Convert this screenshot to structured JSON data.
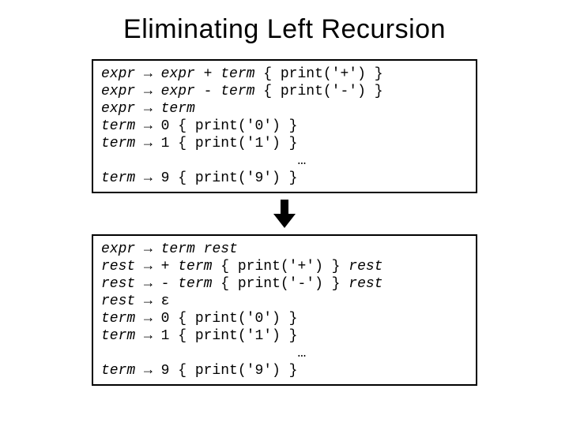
{
  "title": "Eliminating Left Recursion",
  "arrow": "→",
  "epsilon": "ε",
  "ellipsis": "…",
  "grammar1": {
    "lines": [
      {
        "lhs": "expr",
        "rhs_pre": "",
        "rhs_nt": "expr",
        "rhs_mid": " + ",
        "rhs_nt2": "term",
        "rhs_post": " { print('+') }"
      },
      {
        "lhs": "expr",
        "rhs_pre": "",
        "rhs_nt": "expr",
        "rhs_mid": " - ",
        "rhs_nt2": "term",
        "rhs_post": " { print('-') }"
      },
      {
        "lhs": "expr",
        "rhs_pre": "",
        "rhs_nt": "term",
        "rhs_mid": "",
        "rhs_nt2": "",
        "rhs_post": ""
      },
      {
        "lhs": "term",
        "rhs_pre": "0 { print('0') }",
        "rhs_nt": "",
        "rhs_mid": "",
        "rhs_nt2": "",
        "rhs_post": ""
      },
      {
        "lhs": "term",
        "rhs_pre": "1 { print('1') }",
        "rhs_nt": "",
        "rhs_mid": "",
        "rhs_nt2": "",
        "rhs_post": ""
      }
    ],
    "last": {
      "lhs": "term",
      "rhs_pre": "9 { print('9') }"
    }
  },
  "grammar2": {
    "lines": [
      {
        "lhs": "expr",
        "rhs_pre": "",
        "rhs_nt": "term",
        "rhs_mid": " ",
        "rhs_nt2": "rest",
        "rhs_post": ""
      },
      {
        "lhs": "rest",
        "rhs_pre": "+ ",
        "rhs_nt": "term",
        "rhs_mid": " { print('+') } ",
        "rhs_nt2": "rest",
        "rhs_post": ""
      },
      {
        "lhs": "rest",
        "rhs_pre": "- ",
        "rhs_nt": "term",
        "rhs_mid": " { print('-') } ",
        "rhs_nt2": "rest",
        "rhs_post": ""
      },
      {
        "lhs": "rest",
        "rhs_pre": "",
        "rhs_nt": "",
        "rhs_mid": "",
        "rhs_nt2": "",
        "rhs_post": "",
        "epsilon": true
      },
      {
        "lhs": "term",
        "rhs_pre": "0 { print('0') }",
        "rhs_nt": "",
        "rhs_mid": "",
        "rhs_nt2": "",
        "rhs_post": ""
      },
      {
        "lhs": "term",
        "rhs_pre": "1 { print('1') }",
        "rhs_nt": "",
        "rhs_mid": "",
        "rhs_nt2": "",
        "rhs_post": ""
      }
    ],
    "last": {
      "lhs": "term",
      "rhs_pre": "9 { print('9') }"
    }
  }
}
